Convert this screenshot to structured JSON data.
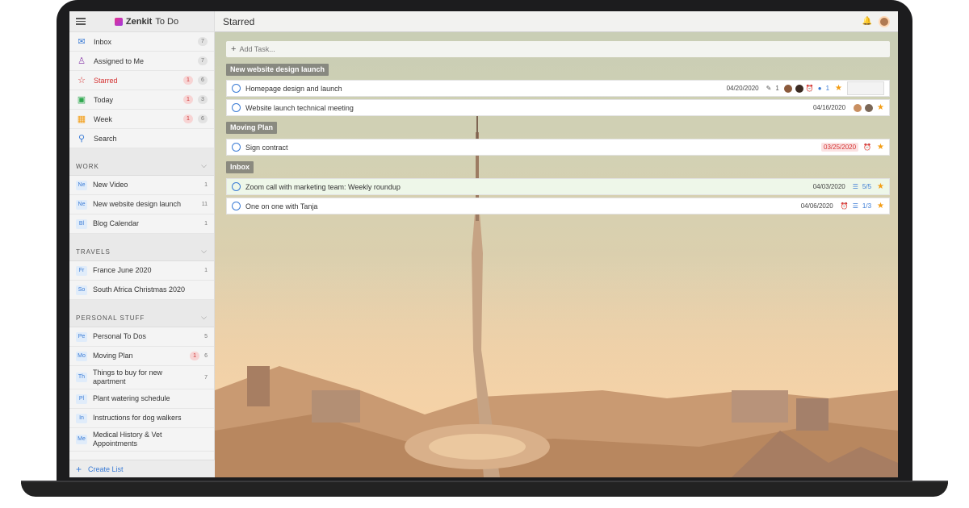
{
  "app": {
    "brand_prefix": "Zenkit",
    "brand_suffix": "To Do"
  },
  "header": {
    "title": "Starred"
  },
  "sidebar": {
    "nav": [
      {
        "label": "Inbox",
        "count": "7",
        "badge": ""
      },
      {
        "label": "Assigned to Me",
        "count": "7",
        "badge": ""
      },
      {
        "label": "Starred",
        "count": "6",
        "badge": "1"
      },
      {
        "label": "Today",
        "count": "3",
        "badge": "1"
      },
      {
        "label": "Week",
        "count": "6",
        "badge": "1"
      },
      {
        "label": "Search",
        "count": "",
        "badge": ""
      }
    ],
    "sections": [
      {
        "title": "WORK",
        "lists": [
          {
            "prefix": "Ne",
            "label": "New Video",
            "count": "1"
          },
          {
            "prefix": "Ne",
            "label": "New website design launch",
            "count": "11"
          },
          {
            "prefix": "Bl",
            "label": "Blog Calendar",
            "count": "1"
          }
        ]
      },
      {
        "title": "TRAVELS",
        "lists": [
          {
            "prefix": "Fr",
            "label": "France June 2020",
            "count": "1"
          },
          {
            "prefix": "So",
            "label": "South Africa Christmas 2020",
            "count": ""
          }
        ]
      },
      {
        "title": "PERSONAL STUFF",
        "lists": [
          {
            "prefix": "Pe",
            "label": "Personal To Dos",
            "count": "5"
          },
          {
            "prefix": "Mo",
            "label": "Moving Plan",
            "count": "6",
            "badge": "1"
          },
          {
            "prefix": "Th",
            "label": "Things to buy for new apartment",
            "count": "7"
          },
          {
            "prefix": "Pl",
            "label": "Plant watering schedule",
            "count": ""
          },
          {
            "prefix": "In",
            "label": "Instructions for dog walkers",
            "count": ""
          },
          {
            "prefix": "Me",
            "label": "Medical History & Vet Appointments",
            "count": ""
          }
        ]
      }
    ],
    "create_label": "Create List"
  },
  "main": {
    "add_task_placeholder": "Add Task...",
    "groups": [
      {
        "title": "New website design launch",
        "tasks": [
          {
            "title": "Homepage design and launch",
            "date": "04/20/2020",
            "attachments": "1",
            "comments": "1"
          },
          {
            "title": "Website launch technical meeting",
            "date": "04/16/2020"
          }
        ]
      },
      {
        "title": "Moving Plan",
        "tasks": [
          {
            "title": "Sign contract",
            "date": "03/25/2020"
          }
        ]
      },
      {
        "title": "Inbox",
        "tasks": [
          {
            "title": "Zoom call with marketing team: Weekly roundup",
            "date": "04/03/2020",
            "checklist": "5/5"
          },
          {
            "title": "One on one with Tanja",
            "date": "04/06/2020",
            "checklist": "1/3"
          }
        ]
      }
    ]
  },
  "colors": {
    "accent": "#3a7bd5",
    "overdue": "#d43030",
    "star": "#f39c12"
  }
}
